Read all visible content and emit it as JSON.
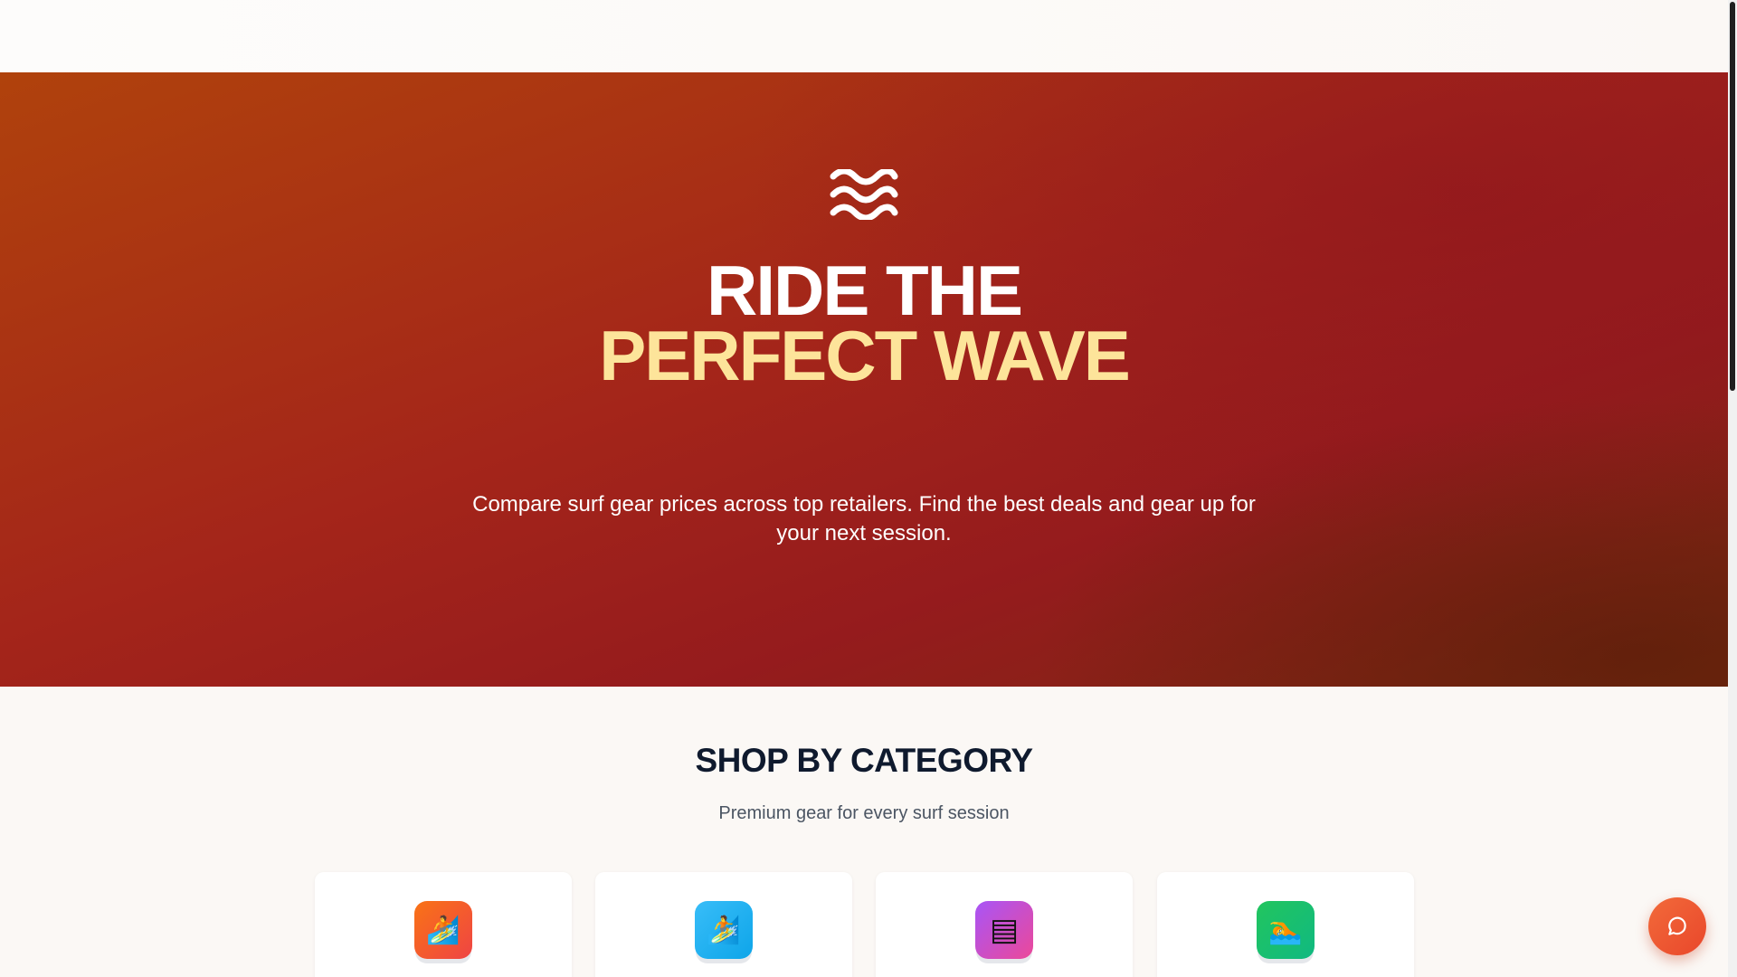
{
  "hero": {
    "icon": "waves-icon",
    "title_line1": "RIDE THE",
    "title_line2": "PERFECT WAVE",
    "subtitle": "Compare surf gear prices across top retailers. Find the best deals and gear up for your next session."
  },
  "categories": {
    "title": "SHOP BY CATEGORY",
    "subtitle": "Premium gear for every surf session",
    "items": [
      {
        "icon": "surfer-icon",
        "glyph": "🏄",
        "color_from": "#f97316",
        "color_to": "#ef4444"
      },
      {
        "icon": "surfer-icon",
        "glyph": "🏄",
        "color_from": "#38bdf8",
        "color_to": "#0ea5e9"
      },
      {
        "icon": "wetsuit-icon",
        "glyph": "▤",
        "color_from": "#a855f7",
        "color_to": "#ec4899"
      },
      {
        "icon": "swimmer-icon",
        "glyph": "🏊",
        "color_from": "#22c55e",
        "color_to": "#10b981"
      }
    ]
  },
  "chat": {
    "icon": "chat-bubble-icon"
  },
  "colors": {
    "hero_accent": "#fde49a",
    "heading_dark": "#0f1a2e",
    "chat_button": "#ef5a32"
  }
}
